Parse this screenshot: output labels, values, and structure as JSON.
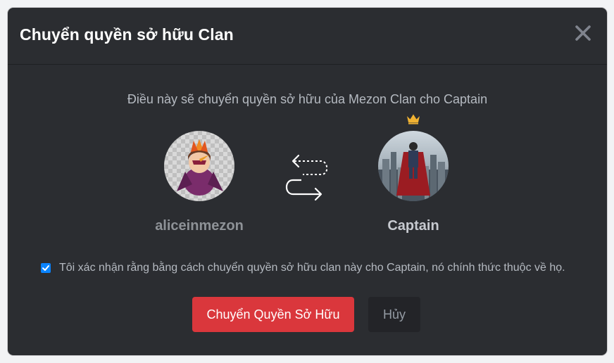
{
  "dialog": {
    "title": "Chuyển quyền sở hữu Clan",
    "subtitle": "Điều này sẽ chuyển quyền sở hữu của Mezon Clan cho Captain",
    "from_user": {
      "name": "aliceinmezon"
    },
    "to_user": {
      "name": "Captain"
    },
    "confirm_checked": true,
    "confirm_text": "Tôi xác nhận rằng bằng cách chuyển quyền sở hữu clan này cho Captain, nó chính thức thuộc về họ.",
    "primary_button_label": "Chuyển Quyền Sở Hữu",
    "cancel_button_label": "Hủy"
  },
  "icons": {
    "close": "close-icon",
    "crown": "crown-icon",
    "swap": "swap-arrows-icon",
    "check": "checkmark-icon"
  },
  "colors": {
    "background": "#2b2d31",
    "primary_button": "#da373c",
    "checkbox": "#0a84ff",
    "crown": "#f0b232"
  }
}
